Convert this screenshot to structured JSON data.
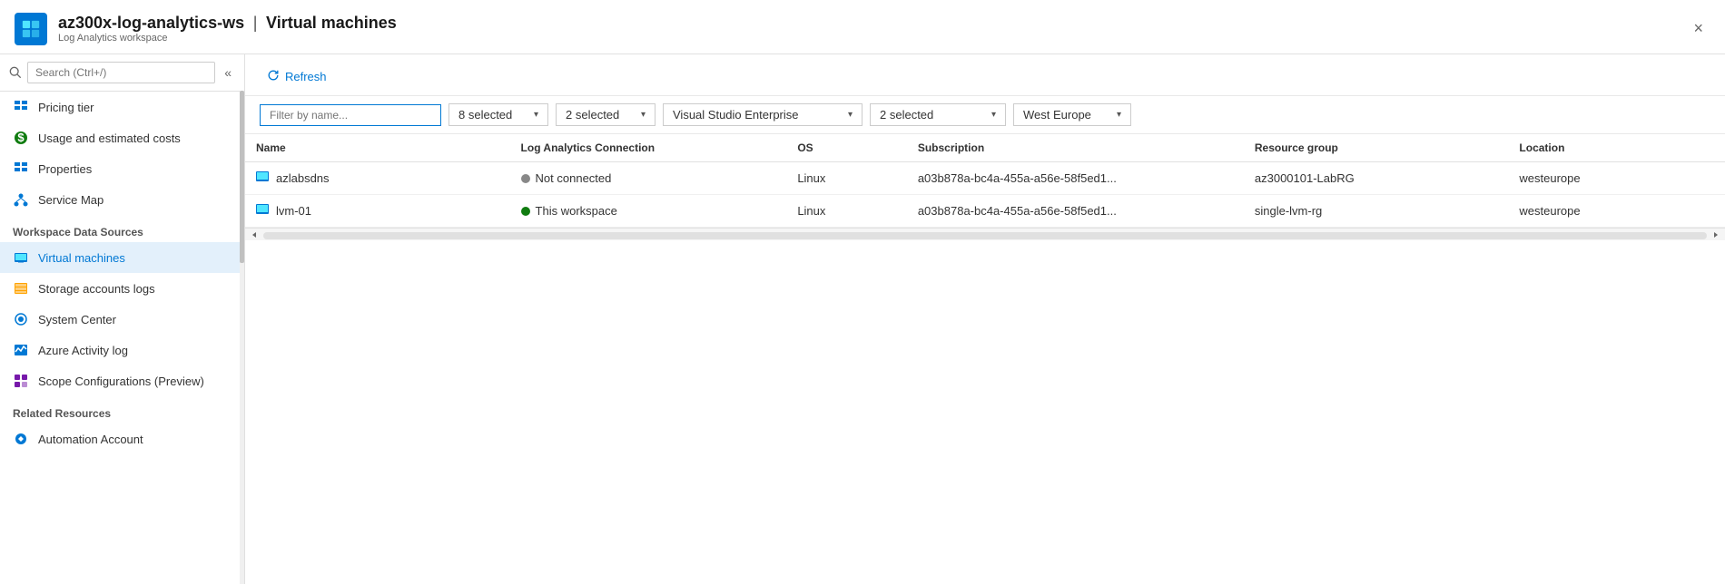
{
  "header": {
    "workspace_name": "az300x-log-analytics-ws",
    "separator": "|",
    "page_title": "Virtual machines",
    "subtitle": "Log Analytics workspace",
    "close_label": "×"
  },
  "sidebar": {
    "search_placeholder": "Search (Ctrl+/)",
    "collapse_icon": "«",
    "items": [
      {
        "id": "pricing-tier",
        "label": "Pricing tier",
        "icon": "grid-icon"
      },
      {
        "id": "usage-costs",
        "label": "Usage and estimated costs",
        "icon": "circle-icon"
      },
      {
        "id": "properties",
        "label": "Properties",
        "icon": "grid-icon"
      },
      {
        "id": "service-map",
        "label": "Service Map",
        "icon": "nodes-icon"
      }
    ],
    "section_workspace": "Workspace Data Sources",
    "workspace_items": [
      {
        "id": "virtual-machines",
        "label": "Virtual machines",
        "icon": "vm-icon",
        "active": true
      },
      {
        "id": "storage-accounts-logs",
        "label": "Storage accounts logs",
        "icon": "storage-icon"
      },
      {
        "id": "system-center",
        "label": "System Center",
        "icon": "system-icon"
      },
      {
        "id": "azure-activity-log",
        "label": "Azure Activity log",
        "icon": "activity-icon"
      },
      {
        "id": "scope-configurations",
        "label": "Scope Configurations (Preview)",
        "icon": "scope-icon"
      }
    ],
    "section_related": "Related Resources",
    "related_items": [
      {
        "id": "automation-account",
        "label": "Automation Account",
        "icon": "auto-icon"
      }
    ]
  },
  "toolbar": {
    "refresh_label": "Refresh",
    "refresh_icon": "refresh-icon"
  },
  "filters": {
    "name_placeholder": "Filter by name...",
    "dropdown1_label": "8 selected",
    "dropdown2_label": "2 selected",
    "dropdown3_label": "Visual Studio Enterprise",
    "dropdown4_label": "2 selected",
    "dropdown5_label": "West Europe"
  },
  "table": {
    "columns": [
      "Name",
      "Log Analytics Connection",
      "OS",
      "Subscription",
      "Resource group",
      "Location"
    ],
    "rows": [
      {
        "name": "azlabsdns",
        "connection": "Not connected",
        "connection_status": "gray",
        "os": "Linux",
        "subscription": "a03b878a-bc4a-455a-a56e-58f5ed1...",
        "resource_group": "az3000101-LabRG",
        "location": "westeurope"
      },
      {
        "name": "lvm-01",
        "connection": "This workspace",
        "connection_status": "green",
        "os": "Linux",
        "subscription": "a03b878a-bc4a-455a-a56e-58f5ed1...",
        "resource_group": "single-lvm-rg",
        "location": "westeurope"
      }
    ]
  }
}
